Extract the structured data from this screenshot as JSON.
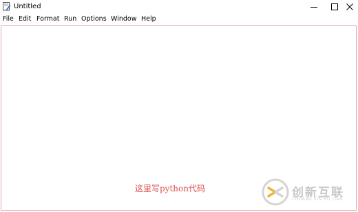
{
  "window": {
    "title": "Untitled",
    "controls": {
      "minimize_icon": "minimize-icon",
      "maximize_icon": "maximize-icon",
      "close_icon": "close-icon"
    }
  },
  "menubar": {
    "items": [
      "File",
      "Edit",
      "Format",
      "Run",
      "Options",
      "Window",
      "Help"
    ]
  },
  "editor": {
    "content": "",
    "note": "这里写python代码",
    "border_color": "#e2a4a4",
    "note_color": "#d9534f"
  },
  "watermark": {
    "text": "创新互联",
    "subtext": "CHUANG XIN HU LIAN"
  }
}
